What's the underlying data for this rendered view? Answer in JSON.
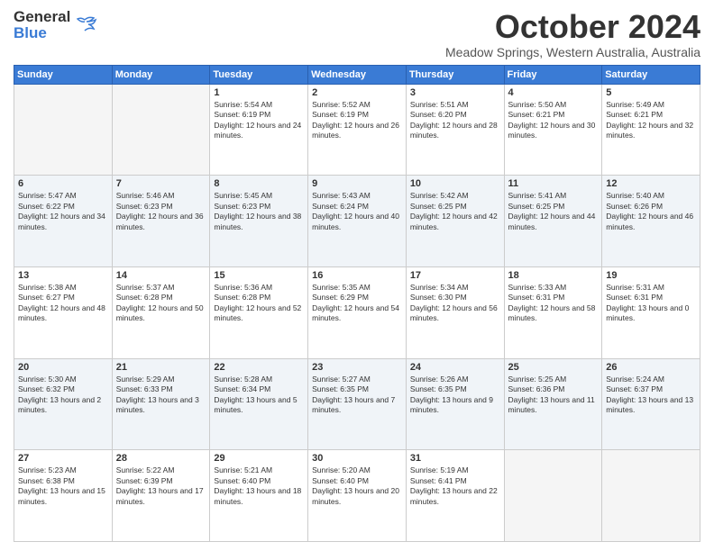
{
  "logo": {
    "general": "General",
    "blue": "Blue"
  },
  "header": {
    "month": "October 2024",
    "location": "Meadow Springs, Western Australia, Australia"
  },
  "weekdays": [
    "Sunday",
    "Monday",
    "Tuesday",
    "Wednesday",
    "Thursday",
    "Friday",
    "Saturday"
  ],
  "weeks": [
    [
      {
        "day": "",
        "info": ""
      },
      {
        "day": "",
        "info": ""
      },
      {
        "day": "1",
        "info": "Sunrise: 5:54 AM\nSunset: 6:19 PM\nDaylight: 12 hours and 24 minutes."
      },
      {
        "day": "2",
        "info": "Sunrise: 5:52 AM\nSunset: 6:19 PM\nDaylight: 12 hours and 26 minutes."
      },
      {
        "day": "3",
        "info": "Sunrise: 5:51 AM\nSunset: 6:20 PM\nDaylight: 12 hours and 28 minutes."
      },
      {
        "day": "4",
        "info": "Sunrise: 5:50 AM\nSunset: 6:21 PM\nDaylight: 12 hours and 30 minutes."
      },
      {
        "day": "5",
        "info": "Sunrise: 5:49 AM\nSunset: 6:21 PM\nDaylight: 12 hours and 32 minutes."
      }
    ],
    [
      {
        "day": "6",
        "info": "Sunrise: 5:47 AM\nSunset: 6:22 PM\nDaylight: 12 hours and 34 minutes."
      },
      {
        "day": "7",
        "info": "Sunrise: 5:46 AM\nSunset: 6:23 PM\nDaylight: 12 hours and 36 minutes."
      },
      {
        "day": "8",
        "info": "Sunrise: 5:45 AM\nSunset: 6:23 PM\nDaylight: 12 hours and 38 minutes."
      },
      {
        "day": "9",
        "info": "Sunrise: 5:43 AM\nSunset: 6:24 PM\nDaylight: 12 hours and 40 minutes."
      },
      {
        "day": "10",
        "info": "Sunrise: 5:42 AM\nSunset: 6:25 PM\nDaylight: 12 hours and 42 minutes."
      },
      {
        "day": "11",
        "info": "Sunrise: 5:41 AM\nSunset: 6:25 PM\nDaylight: 12 hours and 44 minutes."
      },
      {
        "day": "12",
        "info": "Sunrise: 5:40 AM\nSunset: 6:26 PM\nDaylight: 12 hours and 46 minutes."
      }
    ],
    [
      {
        "day": "13",
        "info": "Sunrise: 5:38 AM\nSunset: 6:27 PM\nDaylight: 12 hours and 48 minutes."
      },
      {
        "day": "14",
        "info": "Sunrise: 5:37 AM\nSunset: 6:28 PM\nDaylight: 12 hours and 50 minutes."
      },
      {
        "day": "15",
        "info": "Sunrise: 5:36 AM\nSunset: 6:28 PM\nDaylight: 12 hours and 52 minutes."
      },
      {
        "day": "16",
        "info": "Sunrise: 5:35 AM\nSunset: 6:29 PM\nDaylight: 12 hours and 54 minutes."
      },
      {
        "day": "17",
        "info": "Sunrise: 5:34 AM\nSunset: 6:30 PM\nDaylight: 12 hours and 56 minutes."
      },
      {
        "day": "18",
        "info": "Sunrise: 5:33 AM\nSunset: 6:31 PM\nDaylight: 12 hours and 58 minutes."
      },
      {
        "day": "19",
        "info": "Sunrise: 5:31 AM\nSunset: 6:31 PM\nDaylight: 13 hours and 0 minutes."
      }
    ],
    [
      {
        "day": "20",
        "info": "Sunrise: 5:30 AM\nSunset: 6:32 PM\nDaylight: 13 hours and 2 minutes."
      },
      {
        "day": "21",
        "info": "Sunrise: 5:29 AM\nSunset: 6:33 PM\nDaylight: 13 hours and 3 minutes."
      },
      {
        "day": "22",
        "info": "Sunrise: 5:28 AM\nSunset: 6:34 PM\nDaylight: 13 hours and 5 minutes."
      },
      {
        "day": "23",
        "info": "Sunrise: 5:27 AM\nSunset: 6:35 PM\nDaylight: 13 hours and 7 minutes."
      },
      {
        "day": "24",
        "info": "Sunrise: 5:26 AM\nSunset: 6:35 PM\nDaylight: 13 hours and 9 minutes."
      },
      {
        "day": "25",
        "info": "Sunrise: 5:25 AM\nSunset: 6:36 PM\nDaylight: 13 hours and 11 minutes."
      },
      {
        "day": "26",
        "info": "Sunrise: 5:24 AM\nSunset: 6:37 PM\nDaylight: 13 hours and 13 minutes."
      }
    ],
    [
      {
        "day": "27",
        "info": "Sunrise: 5:23 AM\nSunset: 6:38 PM\nDaylight: 13 hours and 15 minutes."
      },
      {
        "day": "28",
        "info": "Sunrise: 5:22 AM\nSunset: 6:39 PM\nDaylight: 13 hours and 17 minutes."
      },
      {
        "day": "29",
        "info": "Sunrise: 5:21 AM\nSunset: 6:40 PM\nDaylight: 13 hours and 18 minutes."
      },
      {
        "day": "30",
        "info": "Sunrise: 5:20 AM\nSunset: 6:40 PM\nDaylight: 13 hours and 20 minutes."
      },
      {
        "day": "31",
        "info": "Sunrise: 5:19 AM\nSunset: 6:41 PM\nDaylight: 13 hours and 22 minutes."
      },
      {
        "day": "",
        "info": ""
      },
      {
        "day": "",
        "info": ""
      }
    ]
  ]
}
